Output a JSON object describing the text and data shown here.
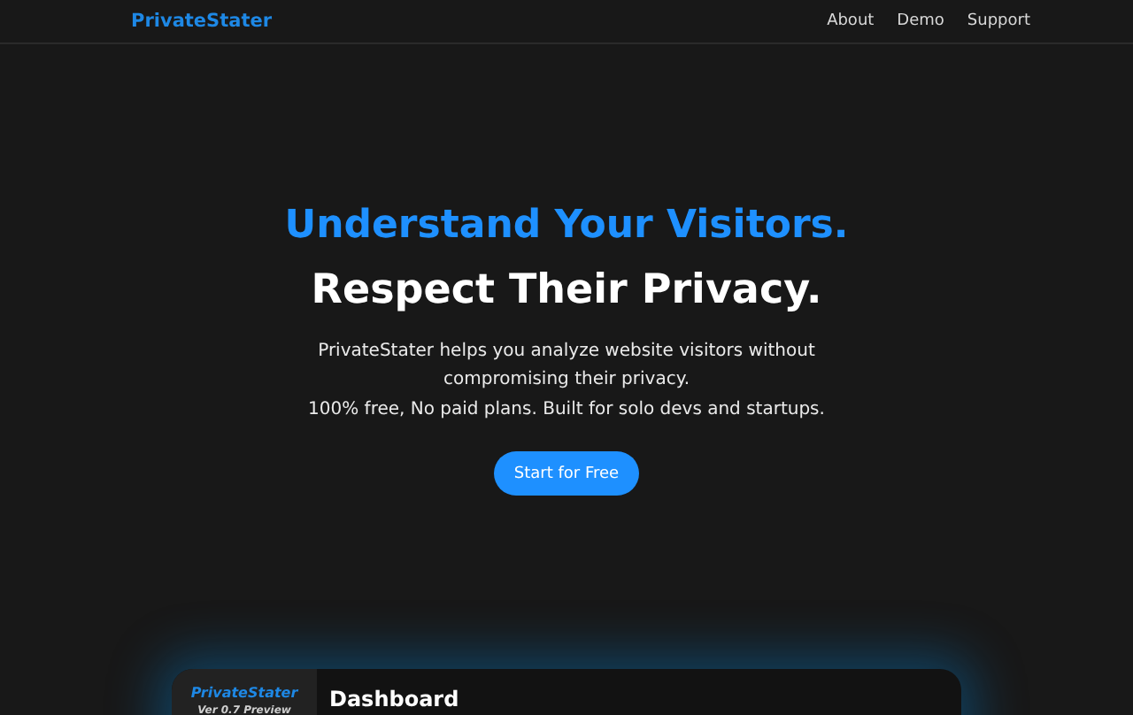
{
  "header": {
    "brand": "PrivateStater",
    "nav": [
      "About",
      "Demo",
      "Support"
    ]
  },
  "hero": {
    "headline": "Understand Your Visitors.",
    "subheadline": "Respect Their Privacy.",
    "description": "PrivateStater helps you analyze website visitors without compromising their privacy.",
    "tagline": "100% free, No paid plans. Built for solo devs and startups.",
    "cta": "Start for Free"
  },
  "preview": {
    "brand": "PrivateStater",
    "version": "Ver 0.7 Preview",
    "title": "Dashboard"
  }
}
